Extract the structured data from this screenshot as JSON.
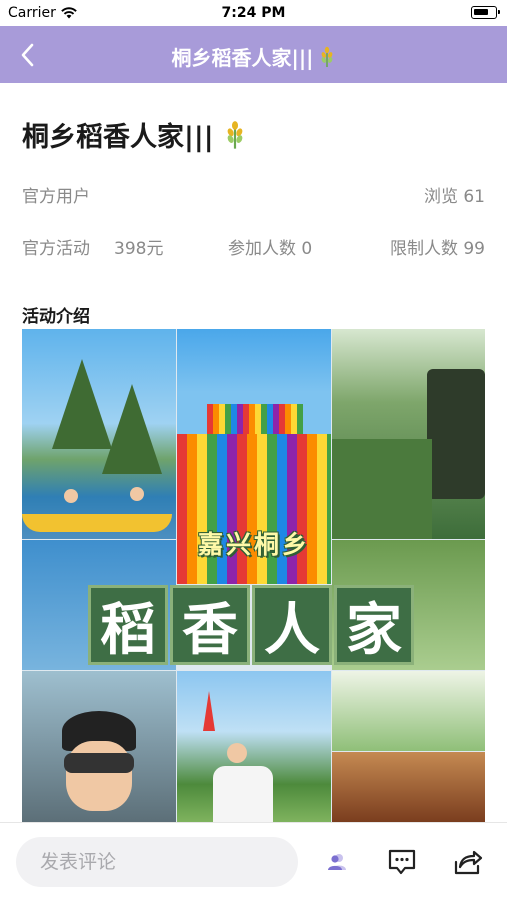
{
  "status_bar": {
    "carrier": "Carrier",
    "time": "7:24 PM"
  },
  "nav": {
    "title": "桐乡稻香人家|||",
    "title_icon": "wheat-icon"
  },
  "activity": {
    "title": "桐乡稻香人家|||",
    "organizer": "官方用户",
    "views": "浏览 61",
    "type": "官方活动",
    "price": "398元",
    "participants": "参加人数 0",
    "limit": "限制人数 99"
  },
  "intro": {
    "section_title": "活动介绍",
    "poster_subtitle": "嘉兴桐乡",
    "poster_title": [
      "稻",
      "香",
      "人",
      "家"
    ]
  },
  "bottom_bar": {
    "comment_placeholder": "发表评论",
    "icons": [
      "users-icon",
      "comment-icon",
      "share-icon"
    ]
  },
  "colors": {
    "nav_bg": "#a89bd9",
    "accent": "#7b6fd0"
  }
}
